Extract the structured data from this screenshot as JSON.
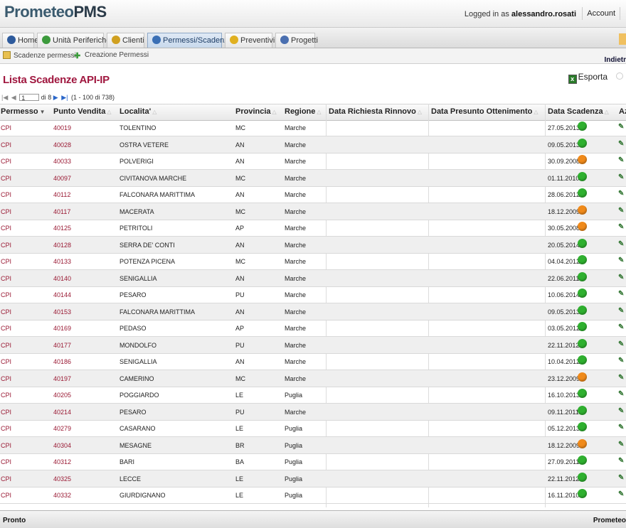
{
  "app": {
    "logo_a": "Prometeo",
    "logo_b": "PMS"
  },
  "header": {
    "logged_prefix": "Logged in as ",
    "user": "alessandro.rosati",
    "account": "Account"
  },
  "tabs": [
    {
      "label": "Home",
      "color": "#2d5a9c",
      "active": false
    },
    {
      "label": "Unità Periferiche",
      "color": "#3c9a3c",
      "active": false
    },
    {
      "label": "Clienti",
      "color": "#d0a020",
      "active": false
    },
    {
      "label": "Permessi/Scadenze",
      "color": "#3a6fb5",
      "active": true
    },
    {
      "label": "Preventivi",
      "color": "#e0b020",
      "active": false
    },
    {
      "label": "Progetti",
      "color": "#4a6fb0",
      "active": false
    }
  ],
  "subnav": {
    "item1": "Scadenze permessi",
    "item2": "Creazione Permessi",
    "back": "Indietr"
  },
  "page": {
    "title": "Lista Scadenze API-IP",
    "export": "Esporta"
  },
  "pager": {
    "page": "1",
    "of": "di 8",
    "range": "(1 - 100 di 738)"
  },
  "columns": [
    "Permesso",
    "Punto Vendita",
    "Localita'",
    "Provincia",
    "Regione",
    "Data Richiesta Rinnovo",
    "Data Presunto Ottenimento",
    "Data Scadenza",
    "Az"
  ],
  "status_colors": {
    "ok": "#2fb02f",
    "warn": "#f08a1a"
  },
  "rows": [
    {
      "permesso": "CPI",
      "pv": "40019",
      "localita": "TOLENTINO",
      "prov": "MC",
      "regione": "Marche",
      "scadenza": "27.05.2013",
      "status": "ok"
    },
    {
      "permesso": "CPI",
      "pv": "40028",
      "localita": "OSTRA VETERE",
      "prov": "AN",
      "regione": "Marche",
      "scadenza": "09.05.2013",
      "status": "ok"
    },
    {
      "permesso": "CPI",
      "pv": "40033",
      "localita": "POLVERIGI",
      "prov": "AN",
      "regione": "Marche",
      "scadenza": "30.09.2008",
      "status": "warn"
    },
    {
      "permesso": "CPI",
      "pv": "40097",
      "localita": "CIVITANOVA MARCHE",
      "prov": "MC",
      "regione": "Marche",
      "scadenza": "01.11.2010",
      "status": "ok"
    },
    {
      "permesso": "CPI",
      "pv": "40112",
      "localita": "FALCONARA MARITTIMA",
      "prov": "AN",
      "regione": "Marche",
      "scadenza": "28.06.2012",
      "status": "ok"
    },
    {
      "permesso": "CPI",
      "pv": "40117",
      "localita": "MACERATA",
      "prov": "MC",
      "regione": "Marche",
      "scadenza": "18.12.2009",
      "status": "warn"
    },
    {
      "permesso": "CPI",
      "pv": "40125",
      "localita": "PETRITOLI",
      "prov": "AP",
      "regione": "Marche",
      "scadenza": "30.05.2008",
      "status": "warn"
    },
    {
      "permesso": "CPI",
      "pv": "40128",
      "localita": "SERRA DE' CONTI",
      "prov": "AN",
      "regione": "Marche",
      "scadenza": "20.05.2014",
      "status": "ok"
    },
    {
      "permesso": "CPI",
      "pv": "40133",
      "localita": "POTENZA PICENA",
      "prov": "MC",
      "regione": "Marche",
      "scadenza": "04.04.2012",
      "status": "ok"
    },
    {
      "permesso": "CPI",
      "pv": "40140",
      "localita": "SENIGALLIA",
      "prov": "AN",
      "regione": "Marche",
      "scadenza": "22.06.2011",
      "status": "ok"
    },
    {
      "permesso": "CPI",
      "pv": "40144",
      "localita": "PESARO",
      "prov": "PU",
      "regione": "Marche",
      "scadenza": "10.06.2014",
      "status": "ok"
    },
    {
      "permesso": "CPI",
      "pv": "40153",
      "localita": "FALCONARA MARITTIMA",
      "prov": "AN",
      "regione": "Marche",
      "scadenza": "09.05.2013",
      "status": "ok"
    },
    {
      "permesso": "CPI",
      "pv": "40169",
      "localita": "PEDASO",
      "prov": "AP",
      "regione": "Marche",
      "scadenza": "03.05.2012",
      "status": "ok"
    },
    {
      "permesso": "CPI",
      "pv": "40177",
      "localita": "MONDOLFO",
      "prov": "PU",
      "regione": "Marche",
      "scadenza": "22.11.2012",
      "status": "ok"
    },
    {
      "permesso": "CPI",
      "pv": "40186",
      "localita": "SENIGALLIA",
      "prov": "AN",
      "regione": "Marche",
      "scadenza": "10.04.2012",
      "status": "ok"
    },
    {
      "permesso": "CPI",
      "pv": "40197",
      "localita": "CAMERINO",
      "prov": "MC",
      "regione": "Marche",
      "scadenza": "23.12.2009",
      "status": "warn"
    },
    {
      "permesso": "CPI",
      "pv": "40205",
      "localita": "POGGIARDO",
      "prov": "LE",
      "regione": "Puglia",
      "scadenza": "16.10.2013",
      "status": "ok"
    },
    {
      "permesso": "CPI",
      "pv": "40214",
      "localita": "PESARO",
      "prov": "PU",
      "regione": "Marche",
      "scadenza": "09.11.2011",
      "status": "ok"
    },
    {
      "permesso": "CPI",
      "pv": "40279",
      "localita": "CASARANO",
      "prov": "LE",
      "regione": "Puglia",
      "scadenza": "05.12.2013",
      "status": "ok"
    },
    {
      "permesso": "CPI",
      "pv": "40304",
      "localita": "MESAGNE",
      "prov": "BR",
      "regione": "Puglia",
      "scadenza": "18.12.2009",
      "status": "warn"
    },
    {
      "permesso": "CPI",
      "pv": "40312",
      "localita": "BARI",
      "prov": "BA",
      "regione": "Puglia",
      "scadenza": "27.09.2011",
      "status": "ok"
    },
    {
      "permesso": "CPI",
      "pv": "40325",
      "localita": "LECCE",
      "prov": "LE",
      "regione": "Puglia",
      "scadenza": "22.11.2012",
      "status": "ok"
    },
    {
      "permesso": "CPI",
      "pv": "40332",
      "localita": "GIURDIGNANO",
      "prov": "LE",
      "regione": "Puglia",
      "scadenza": "16.11.2010",
      "status": "ok"
    }
  ],
  "statusbar": {
    "left": "Pronto",
    "right": "Prometeo"
  }
}
